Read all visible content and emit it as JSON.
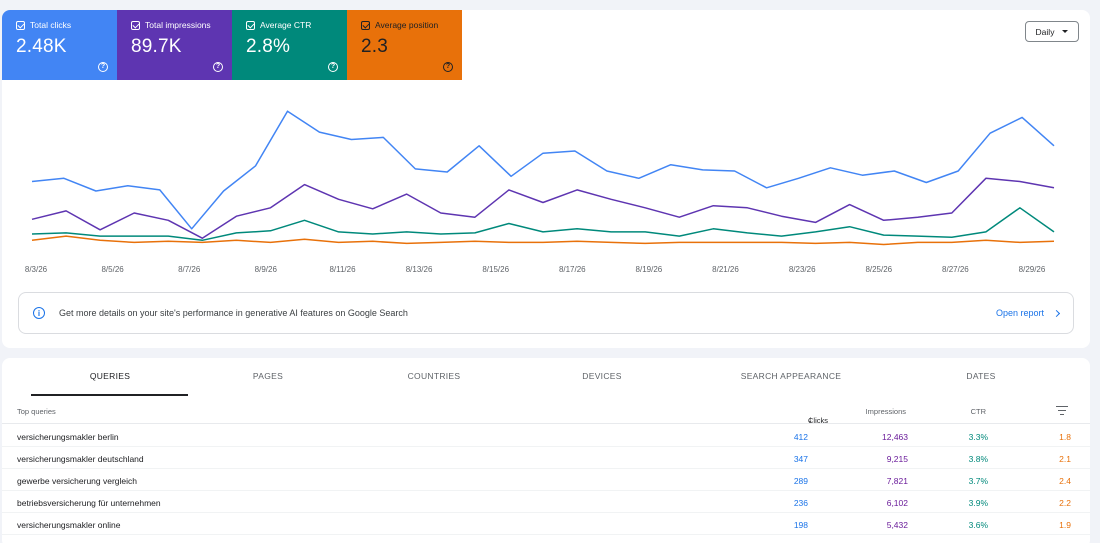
{
  "metrics": [
    {
      "label": "Total clicks",
      "value": "2.48K",
      "color": "#4285f4"
    },
    {
      "label": "Total impressions",
      "value": "89.7K",
      "color": "#5e35b1"
    },
    {
      "label": "Average CTR",
      "value": "2.8%",
      "color": "#00897b"
    },
    {
      "label": "Average position",
      "value": "2.3",
      "color": "#e8710a"
    }
  ],
  "period_select": {
    "value": "Daily"
  },
  "chart_data": {
    "type": "line",
    "x": [
      "8/3/26",
      "8/4/26",
      "8/5/26",
      "8/6/26",
      "8/7/26",
      "8/8/26",
      "8/9/26",
      "8/10/26",
      "8/11/26",
      "8/12/26",
      "8/13/26",
      "8/14/26",
      "8/15/26",
      "8/16/26",
      "8/17/26",
      "8/18/26",
      "8/19/26",
      "8/20/26",
      "8/21/26",
      "8/22/26",
      "8/23/26",
      "8/24/26",
      "8/25/26",
      "8/26/26",
      "8/27/26",
      "8/28/26",
      "8/29/26",
      "8/30/26"
    ],
    "xtick_labels": [
      "8/3/26",
      "8/5/26",
      "8/7/26",
      "8/9/26",
      "8/11/26",
      "8/13/26",
      "8/15/26",
      "8/17/26",
      "8/19/26",
      "8/21/26",
      "8/23/26",
      "8/25/26",
      "8/27/26",
      "8/29/26"
    ],
    "grid": false,
    "legend": "none",
    "series": [
      {
        "color": "#4285f4",
        "values": [
          70,
          73,
          61,
          66,
          62,
          25,
          61,
          85,
          137,
          117,
          110,
          112,
          82,
          79,
          104,
          75,
          97,
          99,
          80,
          73,
          86,
          81,
          80,
          64,
          73,
          83,
          76,
          80,
          69,
          80,
          116,
          131,
          104
        ]
      },
      {
        "color": "#5e35b1",
        "values": [
          34,
          42,
          24,
          40,
          33,
          16,
          37,
          45,
          67,
          53,
          44,
          58,
          40,
          36,
          62,
          50,
          62,
          53,
          45,
          36,
          47,
          45,
          37,
          31,
          48,
          33,
          36,
          40,
          73,
          70,
          64
        ]
      },
      {
        "color": "#00897b",
        "values": [
          20,
          21,
          18,
          18,
          18,
          14,
          21,
          23,
          33,
          22,
          20,
          22,
          20,
          21,
          30,
          22,
          25,
          22,
          22,
          18,
          25,
          21,
          18,
          22,
          27,
          19,
          18,
          17,
          22,
          45,
          22
        ]
      },
      {
        "color": "#e8710a",
        "values": [
          14,
          18,
          14,
          12,
          13,
          12,
          14,
          12,
          15,
          12,
          13,
          11,
          12,
          13,
          12,
          12,
          13,
          12,
          11,
          12,
          12,
          12,
          12,
          11,
          12,
          10,
          12,
          12,
          14,
          12,
          13
        ]
      }
    ]
  },
  "gen_ai_banner": {
    "message": "Get more details on your site's performance in generative AI features on Google Search",
    "link": "Open report"
  },
  "tabs": [
    "QUERIES",
    "PAGES",
    "COUNTRIES",
    "DEVICES",
    "SEARCH APPEARANCE",
    "DATES"
  ],
  "table": {
    "headers": {
      "query": "Top queries",
      "clicks": "Clicks",
      "impressions": "Impressions",
      "ctr": "CTR"
    },
    "rows": [
      {
        "query": "versicherungsmakler berlin",
        "clicks": "412",
        "impressions": "12,463",
        "ctr": "3.3%",
        "position": "1.8"
      },
      {
        "query": "versicherungsmakler deutschland",
        "clicks": "347",
        "impressions": "9,215",
        "ctr": "3.8%",
        "position": "2.1"
      },
      {
        "query": "gewerbe versicherung vergleich",
        "clicks": "289",
        "impressions": "7,821",
        "ctr": "3.7%",
        "position": "2.4"
      },
      {
        "query": "betriebsversicherung für unternehmen",
        "clicks": "236",
        "impressions": "6,102",
        "ctr": "3.9%",
        "position": "2.2"
      },
      {
        "query": "versicherungsmakler online",
        "clicks": "198",
        "impressions": "5,432",
        "ctr": "3.6%",
        "position": "1.9"
      }
    ]
  }
}
